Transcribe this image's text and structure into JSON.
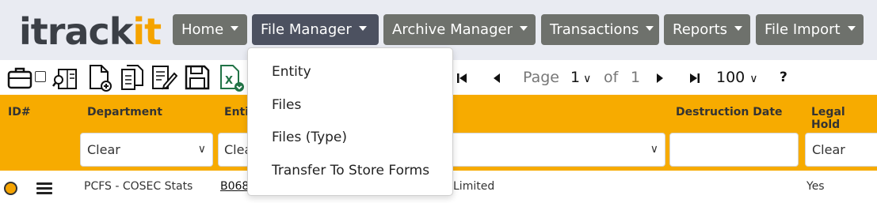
{
  "logo": {
    "part1": "itrack",
    "part2": "it"
  },
  "nav": [
    {
      "label": "Home"
    },
    {
      "label": "File Manager"
    },
    {
      "label": "Archive Manager"
    },
    {
      "label": "Transactions"
    },
    {
      "label": "Reports"
    },
    {
      "label": "File Import"
    }
  ],
  "dropdown": {
    "items": [
      "Entity",
      "Files",
      "Files (Type)",
      "Transfer To Store Forms"
    ]
  },
  "toolbar": {
    "icons": [
      "briefcase-icon",
      "select-all-checkbox",
      "book-search-icon",
      "new-file-icon",
      "copy-files-icon",
      "edit-file-icon",
      "save-icon",
      "excel-export-icon"
    ]
  },
  "pager": {
    "page_label": "Page",
    "page_value": "1",
    "of_label": "of",
    "total_pages": "1",
    "page_size": "100",
    "help": "?"
  },
  "table": {
    "headers": {
      "id": "ID#",
      "department": "Department",
      "entity": "Entity",
      "destruction_date": "Destruction Date",
      "legal_hold": "Legal Hold"
    },
    "filters": {
      "department": "Clear",
      "entity": "Clear",
      "legal_hold": "Clear"
    },
    "row": {
      "department": "PCFS - COSEC Stats",
      "file_no": "B068",
      "entity_name": "Limited",
      "legal_hold": "Yes"
    }
  },
  "colors": {
    "accent": "#f7ab00",
    "nav_bg": "#6e716c",
    "nav_active": "#4c5160",
    "header_bg": "#e9ebf2"
  }
}
